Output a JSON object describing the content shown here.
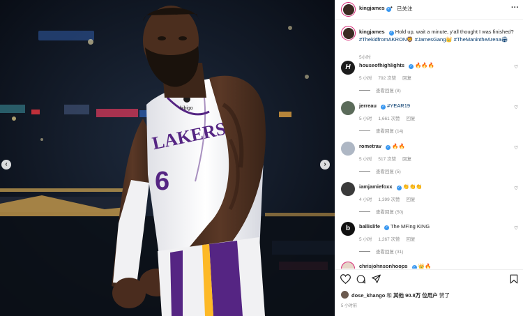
{
  "post": {
    "author": "kingjames",
    "follow_dot": "•",
    "follow_label": "已关注",
    "more_icon": "more-horizontal-icon"
  },
  "caption": {
    "username": "kingjames",
    "text": "Hold up, wait a minute, y'all thought I was finished?",
    "tags": "#ThekidfromAKRON🦁 #JamesGang👑 #TheManintheArena🏟",
    "time": "5小时"
  },
  "comments": [
    {
      "username": "houseofhighlights",
      "verified": true,
      "text": "🔥🔥🔥",
      "time": "5 小时",
      "likes": "792 次赞",
      "reply": "回复",
      "view_replies": "查看回复 (8)",
      "avatar": "H"
    },
    {
      "username": "jerreau",
      "verified": true,
      "text": "#YEAR19",
      "time": "5 小时",
      "likes": "1,661 次赞",
      "reply": "回复",
      "view_replies": "查看回复 (14)",
      "avatar": ""
    },
    {
      "username": "rometrav",
      "verified": true,
      "text": "🔥🔥",
      "time": "5 小时",
      "likes": "517 次赞",
      "reply": "回复",
      "view_replies": "查看回复 (5)",
      "avatar": ""
    },
    {
      "username": "iamjamiefoxx",
      "verified": true,
      "text": "👏👏👏",
      "time": "4 小时",
      "likes": "1,399 次赞",
      "reply": "回复",
      "view_replies": "查看回复 (50)",
      "avatar": ""
    },
    {
      "username": "ballislife",
      "verified": true,
      "text": "The MFing KING",
      "time": "5 小时",
      "likes": "1,267 次赞",
      "reply": "回复",
      "view_replies": "查看回复 (31)",
      "avatar": "b"
    },
    {
      "username": "chrisjohnsonhoops",
      "verified": true,
      "text": "👑🔥",
      "time": "",
      "likes": "",
      "reply": "",
      "view_replies": "",
      "avatar": ""
    }
  ],
  "actions": {
    "like_icon": "heart-icon",
    "comment_icon": "comment-icon",
    "share_icon": "send-icon",
    "save_icon": "bookmark-icon"
  },
  "likes": {
    "user": "dose_khango",
    "middle": " 和 ",
    "others": "其他 90.8万 位用户",
    "suffix": " 赞了"
  },
  "post_time": "5 小时前",
  "photo": {
    "jersey_team": "LAKERS",
    "jersey_number": "6",
    "patch": "bibigo"
  },
  "colors": {
    "verified": "#3897f0",
    "link": "#00376b",
    "muted": "#8e8e8e",
    "lakers_purple": "#552583",
    "lakers_gold": "#fdb927"
  }
}
